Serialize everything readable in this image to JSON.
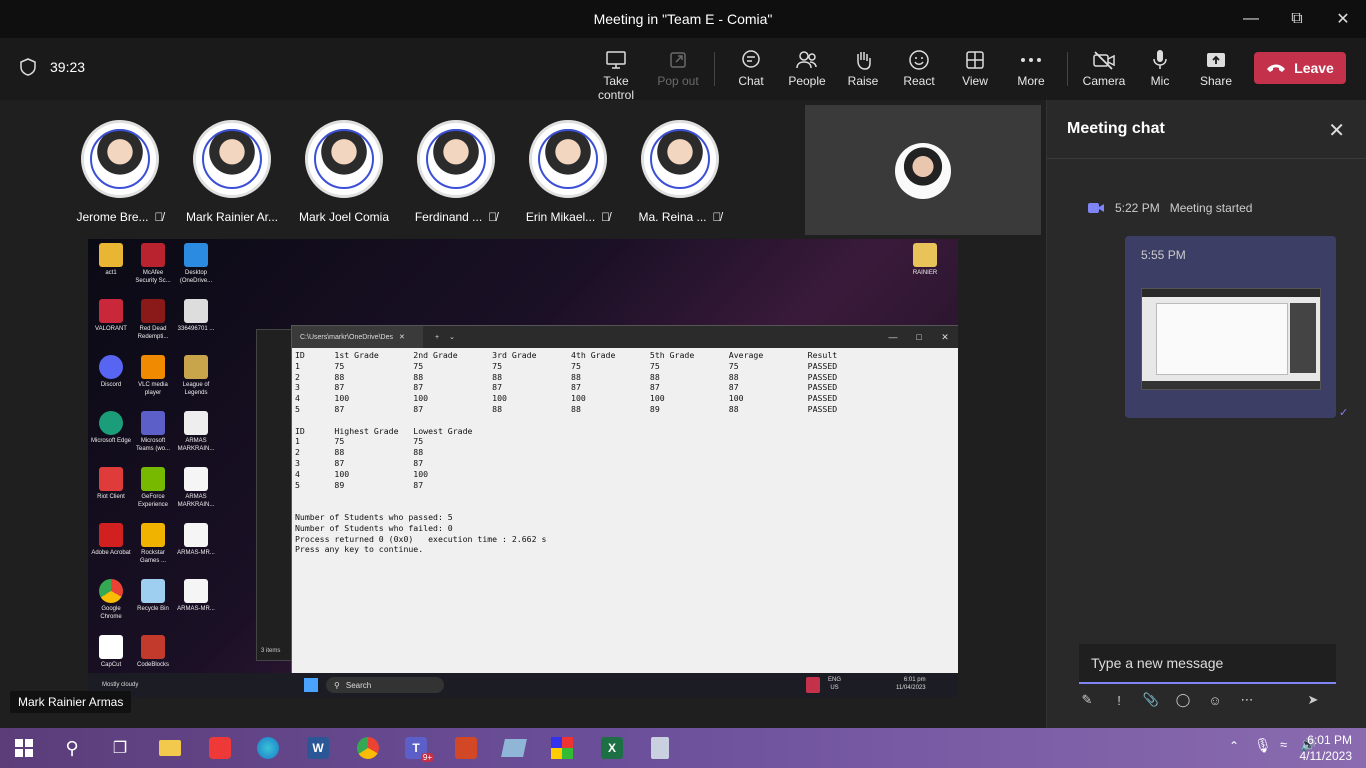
{
  "window": {
    "title": "Meeting in \"Team E - Comia\""
  },
  "toolbar": {
    "timer": "39:23",
    "buttons": [
      {
        "label": "Take control"
      },
      {
        "label": "Pop out"
      },
      {
        "label": "Chat"
      },
      {
        "label": "People"
      },
      {
        "label": "Raise"
      },
      {
        "label": "React"
      },
      {
        "label": "View"
      },
      {
        "label": "More"
      },
      {
        "label": "Camera"
      },
      {
        "label": "Mic"
      },
      {
        "label": "Share"
      }
    ],
    "leave_label": "Leave"
  },
  "participants": [
    {
      "name": "Jerome Bre..."
    },
    {
      "name": "Mark Rainier Ar..."
    },
    {
      "name": "Mark Joel Comia"
    },
    {
      "name": "Ferdinand ..."
    },
    {
      "name": "Erin Mikael..."
    },
    {
      "name": "Ma. Reina ..."
    }
  ],
  "shared_screen": {
    "presenter": "Mark Rainier Armas",
    "console_tab_title": "C:\\Users\\markr\\OneDrive\\Des",
    "console_output": "ID      1st Grade       2nd Grade       3rd Grade       4th Grade       5th Grade       Average         Result\n1       75              75              75              75              75              75              PASSED\n2       88              88              88              88              88              88              PASSED\n3       87              87              87              87              87              87              PASSED\n4       100             100             100             100             100             100             PASSED\n5       87              87              88              88              89              88              PASSED\n\nID      Highest Grade   Lowest Grade\n1       75              75\n2       88              88\n3       87              87\n4       100             100\n5       89              87\n\n\nNumber of Students who passed: 5\nNumber of Students who failed: 0\nProcess returned 0 (0x0)   execution time : 2.662 s\nPress any key to continue.",
    "desktop_icons": [
      "act1",
      "McAfee Security Sc...",
      "Desktop (OneDrive...",
      "VALORANT",
      "Red Dead Redempti...",
      "336496701 ...",
      "Discord",
      "VLC media player",
      "League of Legends",
      "Microsoft Edge",
      "Microsoft Teams (wo...",
      "ARMAS MARKRAIN...",
      "Riot Client",
      "GeForce Experience",
      "ARMAS MARKRAIN...",
      "Adobe Acrobat",
      "Rockstar Games ...",
      "ARMAS-MR...",
      "Google Chrome",
      "Recycle Bin",
      "ARMAS-MR...",
      "CapCut",
      "CodeBlocks",
      "RAINIER"
    ],
    "mini_search": "Search",
    "weather": "Mostly cloudy",
    "mini_lang": "ENG\nUS",
    "mini_time": "6:01 pm",
    "mini_date": "11/04/2023",
    "explorer_items": "3 items"
  },
  "chat": {
    "title": "Meeting chat",
    "started_time": "5:22 PM",
    "started_text": "Meeting started",
    "message_time": "5:55 PM",
    "compose_placeholder": "Type a new message"
  },
  "taskbar": {
    "time": "6:01 PM",
    "date": "4/11/2023",
    "teams_badge": "9+"
  },
  "colors": {
    "accent": "#7f85f5",
    "leave": "#c4314b",
    "bubble": "#3d3e66"
  }
}
